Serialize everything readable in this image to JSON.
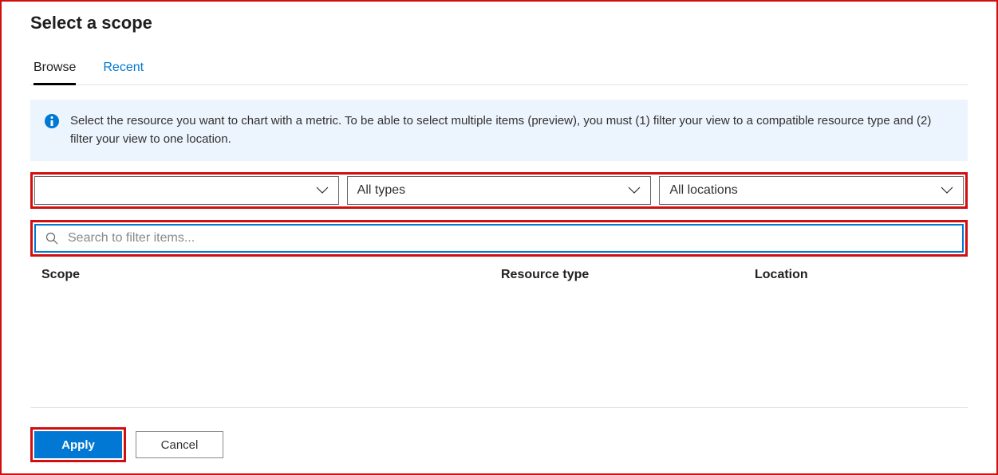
{
  "title": "Select a scope",
  "tabs": [
    {
      "label": "Browse",
      "active": true
    },
    {
      "label": "Recent",
      "active": false
    }
  ],
  "info": {
    "text": "Select the resource you want to chart with a metric. To be able to select multiple items (preview), you must (1) filter your view to a compatible resource type and (2) filter your view to one location."
  },
  "filters": {
    "subscription": {
      "value": ""
    },
    "type": {
      "value": "All types"
    },
    "location": {
      "value": "All locations"
    }
  },
  "search": {
    "placeholder": "Search to filter items..."
  },
  "columns": {
    "scope": "Scope",
    "resource_type": "Resource type",
    "location": "Location"
  },
  "buttons": {
    "apply": "Apply",
    "cancel": "Cancel"
  },
  "colors": {
    "primary": "#0078d4",
    "highlight_border": "#d20f0f",
    "info_bg": "#ecf4fd"
  }
}
